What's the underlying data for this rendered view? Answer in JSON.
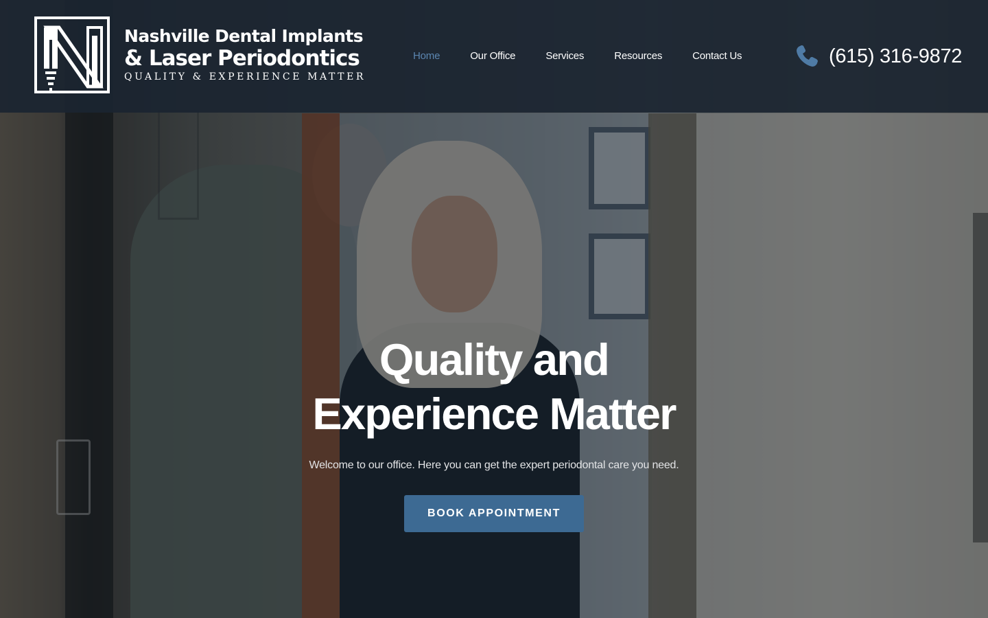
{
  "brand": {
    "name_line1": "Nashville Dental Implants",
    "name_line2": "& Laser Periodontics",
    "tagline": "QUALITY & EXPERIENCE MATTER",
    "logo_icon": "n-implant-logo-icon"
  },
  "nav": {
    "items": [
      {
        "label": "Home",
        "active": true
      },
      {
        "label": "Our Office",
        "active": false
      },
      {
        "label": "Services",
        "active": false
      },
      {
        "label": "Resources",
        "active": false
      },
      {
        "label": "Contact Us",
        "active": false
      }
    ]
  },
  "contact": {
    "phone_icon": "phone-icon",
    "phone": "(615) 316-9872"
  },
  "hero": {
    "title": "Quality and Experience Matter",
    "subtitle": "Welcome to our office. Here you can get the expert periodontal care you need.",
    "cta_label": "BOOK APPOINTMENT"
  },
  "colors": {
    "header_bg": "#1b2530",
    "accent": "#3d6a93",
    "nav_active": "#5b86b1"
  }
}
